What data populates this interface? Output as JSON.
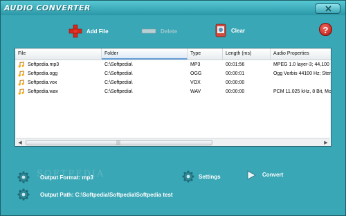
{
  "window": {
    "title": "AUDIO CONVERTER"
  },
  "toolbar": {
    "add_label": "Add File",
    "delete_label": "Delete",
    "clear_label": "Clear",
    "help_label": "?"
  },
  "table": {
    "columns": [
      "File",
      "Folder",
      "Type",
      "Length (ms)",
      "Audio Properties"
    ],
    "rows": [
      {
        "file": "Softpedia.mp3",
        "folder": "C:\\Softpedia\\",
        "type": "MP3",
        "length": "00:01:56",
        "props": "MPEG 1.0 layer-3; 44,100"
      },
      {
        "file": "Softpedia.ogg",
        "folder": "C:\\Softpedia\\",
        "type": "OGG",
        "length": "00:00:01",
        "props": "Ogg Vorbis 44100 Hz; Ster"
      },
      {
        "file": "Softpedia.vox",
        "folder": "C:\\Softpedia\\",
        "type": "VOX",
        "length": "00:00:00",
        "props": ""
      },
      {
        "file": "Softpedia.wav",
        "folder": "C:\\Softpedia\\",
        "type": "WAV",
        "length": "00:00:00",
        "props": "PCM 11.025 kHz, 8 Bit, Mon"
      }
    ]
  },
  "bottom": {
    "output_format": "Output Format: mp3",
    "output_path": "Output Path: C:\\Softpedia\\Softpedia\\Softpedia test",
    "settings_label": "Settings",
    "convert_label": "Convert"
  },
  "watermark": "SOFTPEDIA",
  "colors": {
    "window_bg": "#3aa7b6",
    "add_icon": "#d8261b",
    "help_icon": "#c0180f"
  },
  "icons": {
    "add": "plus-icon",
    "delete": "minus-icon",
    "clear": "clear-icon",
    "help": "help-icon",
    "file": "music-note-icon",
    "settings": "gear-icon",
    "convert": "play-arrow-icon"
  }
}
